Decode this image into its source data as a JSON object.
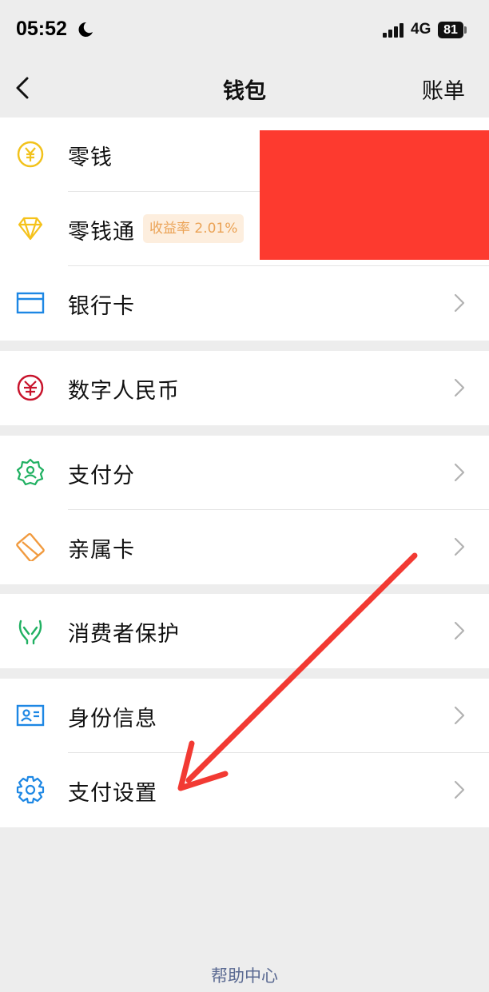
{
  "status_bar": {
    "time": "05:52",
    "network": "4G",
    "battery": "81"
  },
  "nav": {
    "title": "钱包",
    "right_action": "账单",
    "back_icon": "chevron-left-icon"
  },
  "menu_groups": [
    {
      "items": [
        {
          "label": "零钱",
          "icon": "yuan-coin-icon"
        },
        {
          "label": "零钱通",
          "icon": "diamond-icon",
          "badge": "收益率 2.01%"
        },
        {
          "label": "银行卡",
          "icon": "bank-card-icon"
        }
      ]
    },
    {
      "items": [
        {
          "label": "数字人民币",
          "icon": "digital-rmb-icon"
        }
      ]
    },
    {
      "items": [
        {
          "label": "支付分",
          "icon": "pay-score-icon"
        },
        {
          "label": "亲属卡",
          "icon": "family-card-icon"
        }
      ]
    },
    {
      "items": [
        {
          "label": "消费者保护",
          "icon": "consumer-protection-icon"
        }
      ]
    },
    {
      "items": [
        {
          "label": "身份信息",
          "icon": "id-card-icon"
        },
        {
          "label": "支付设置",
          "icon": "gear-icon"
        }
      ]
    }
  ],
  "footer": {
    "help_link": "帮助中心"
  },
  "colors": {
    "background": "#ededed",
    "card": "#ffffff",
    "redaction": "#fd3a2f",
    "annotation_arrow": "#f23a33",
    "link": "#5b6a92"
  }
}
